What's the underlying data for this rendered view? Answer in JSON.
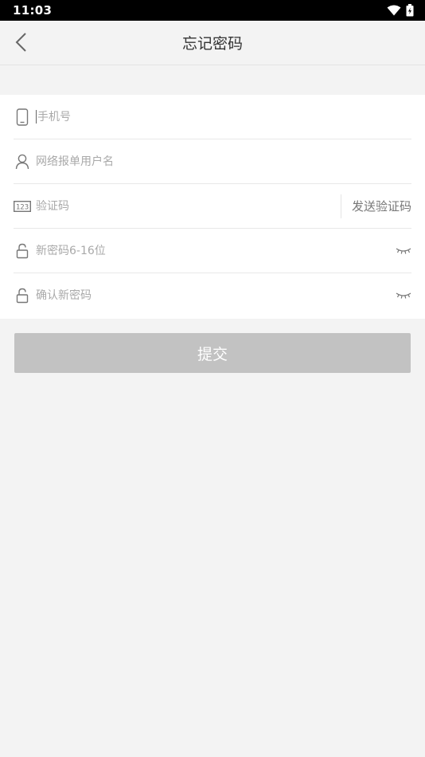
{
  "status_bar": {
    "time": "11:03",
    "icons": [
      "wifi-icon",
      "battery-icon"
    ]
  },
  "header": {
    "title": "忘记密码",
    "back_icon": "chevron-left-icon"
  },
  "form": {
    "phone": {
      "placeholder": "手机号",
      "icon": "smartphone-icon"
    },
    "username": {
      "placeholder": "网络报单用户名",
      "icon": "user-icon"
    },
    "code": {
      "placeholder": "验证码",
      "icon": "numeric-123-icon",
      "send_label": "发送验证码"
    },
    "new_password": {
      "placeholder": "新密码6-16位",
      "icon": "lock-icon",
      "toggle_icon": "eye-closed-icon"
    },
    "confirm_password": {
      "placeholder": "确认新密码",
      "icon": "lock-icon",
      "toggle_icon": "eye-closed-icon"
    }
  },
  "submit": {
    "label": "提交"
  },
  "colors": {
    "background": "#f3f3f3",
    "status_bar": "#000000",
    "card": "#ffffff",
    "button_disabled": "#c2c2c2",
    "placeholder": "#a9a9a9"
  }
}
